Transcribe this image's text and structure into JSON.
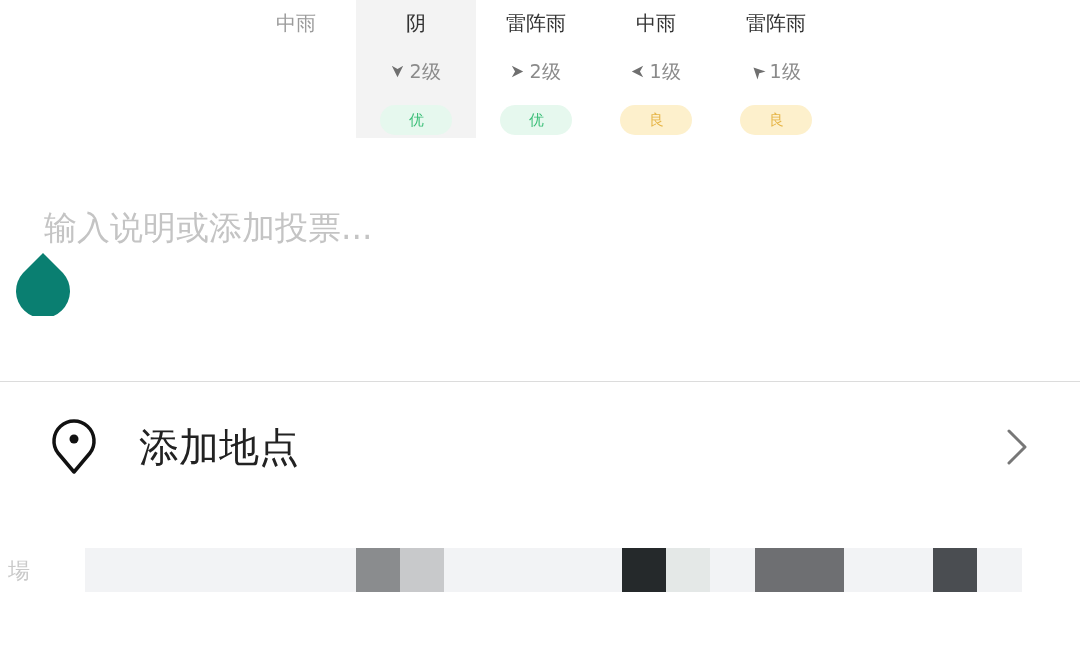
{
  "forecast": [
    {
      "weather": "中雨",
      "selected": false,
      "past": true
    },
    {
      "weather": "阴",
      "selected": true,
      "past": false,
      "wind": {
        "kind": "down",
        "force": "2级"
      },
      "aqi": {
        "label": "优",
        "kind": "excellent"
      }
    },
    {
      "weather": "雷阵雨",
      "selected": false,
      "past": false,
      "wind": {
        "kind": "right",
        "force": "2级"
      },
      "aqi": {
        "label": "优",
        "kind": "excellent"
      }
    },
    {
      "weather": "中雨",
      "selected": false,
      "past": false,
      "wind": {
        "kind": "left",
        "force": "1级"
      },
      "aqi": {
        "label": "良",
        "kind": "good"
      }
    },
    {
      "weather": "雷阵雨",
      "selected": false,
      "past": false,
      "wind": {
        "kind": "upleft",
        "force": "1级"
      },
      "aqi": {
        "label": "良",
        "kind": "good"
      }
    }
  ],
  "composer": {
    "placeholder": "输入说明或添加投票..."
  },
  "location": {
    "label": "添加地点"
  },
  "bottom_strip": {
    "text": "場"
  }
}
